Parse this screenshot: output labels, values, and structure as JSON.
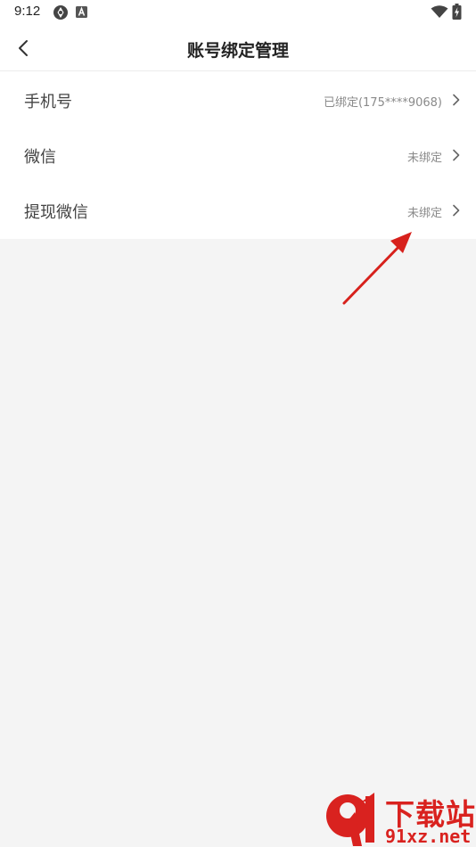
{
  "status_bar": {
    "time": "9:12",
    "icons": [
      "sync-icon",
      "a-badge-icon",
      "wifi-icon",
      "battery-charging-icon"
    ]
  },
  "nav": {
    "back_icon": "chevron-left-icon",
    "title": "账号绑定管理"
  },
  "rows": [
    {
      "label": "手机号",
      "value": "已绑定(175****9068)"
    },
    {
      "label": "微信",
      "value": "未绑定"
    },
    {
      "label": "提现微信",
      "value": "未绑定"
    }
  ],
  "annotation": {
    "color": "#d7211c",
    "icon": "red-arrow-icon"
  },
  "watermark": {
    "brand": "下载站",
    "url": "91xz.net",
    "logo_number": "91",
    "color": "#d9221f"
  },
  "colors": {
    "page_background": "#f4f4f4",
    "card_background": "#ffffff",
    "value_text": "#8a8a8a"
  }
}
